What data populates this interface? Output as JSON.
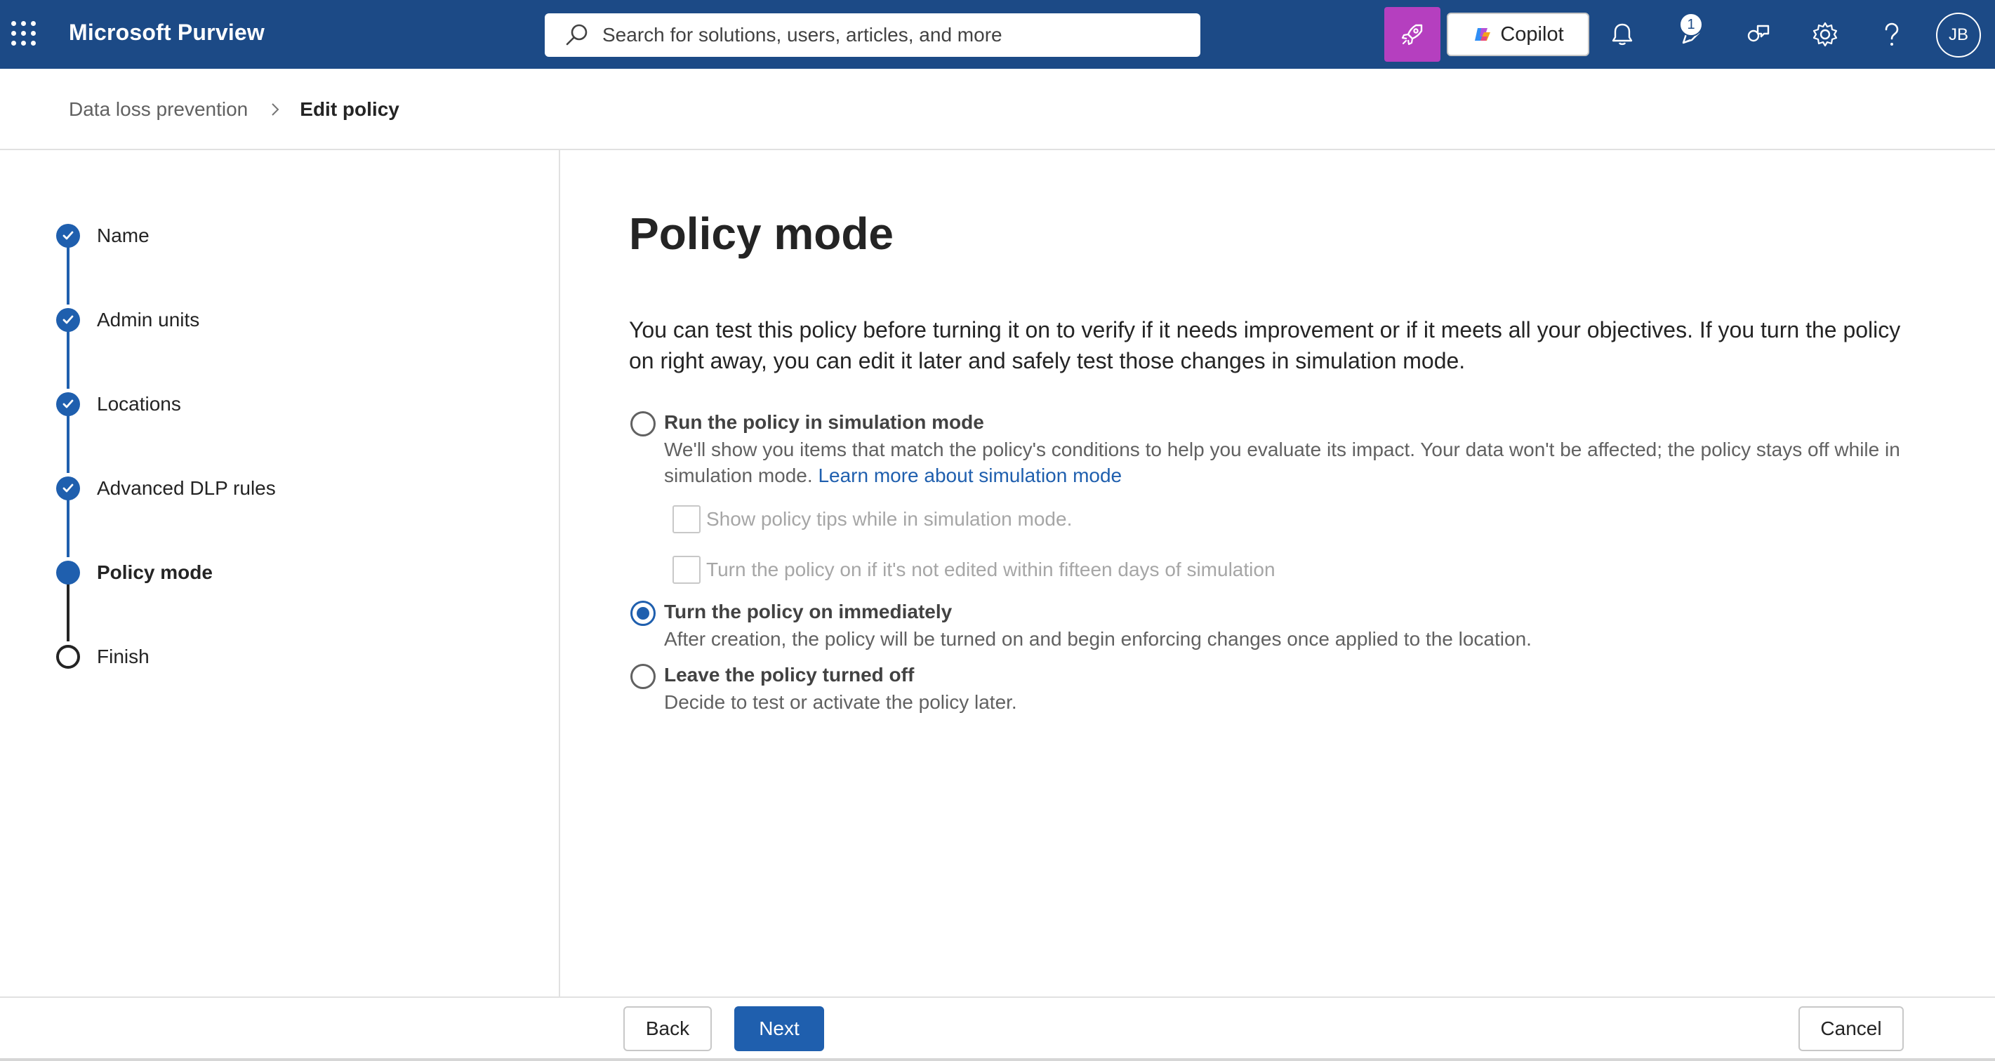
{
  "app": {
    "title": "Microsoft Purview"
  },
  "search": {
    "placeholder": "Search for solutions, users, articles, and more"
  },
  "topbar": {
    "copilot_label": "Copilot",
    "notification_badge": "1",
    "avatar_initials": "JB",
    "colors": {
      "bar": "#1c4a86",
      "rocket": "#b53fbf"
    }
  },
  "breadcrumb": {
    "parent": "Data loss prevention",
    "current": "Edit policy"
  },
  "wizard": {
    "steps": [
      {
        "label": "Name",
        "state": "done"
      },
      {
        "label": "Admin units",
        "state": "done"
      },
      {
        "label": "Locations",
        "state": "done"
      },
      {
        "label": "Advanced DLP rules",
        "state": "done"
      },
      {
        "label": "Policy mode",
        "state": "current"
      },
      {
        "label": "Finish",
        "state": "todo"
      }
    ]
  },
  "main": {
    "title": "Policy mode",
    "description": "You can test this policy before turning it on to verify if it needs improvement or if it meets all your objectives. If you turn the policy on right away, you can edit it later and safely test those changes in simulation mode.",
    "options": [
      {
        "title": "Run the policy in simulation mode",
        "description": "We'll show you items that match the policy's conditions to help you evaluate its impact. Your data won't be affected; the policy stays off while in simulation mode.",
        "link": "Learn more about simulation mode",
        "checked": false,
        "suboptions": [
          {
            "label": "Show policy tips while in simulation mode.",
            "checked": false,
            "disabled": true
          },
          {
            "label": "Turn the policy on if it's not edited within fifteen days of simulation",
            "checked": false,
            "disabled": true
          }
        ]
      },
      {
        "title": "Turn the policy on immediately",
        "description": "After creation, the policy will be turned on and begin enforcing changes once applied to the location.",
        "checked": true
      },
      {
        "title": "Leave the policy turned off",
        "description": "Decide to test or activate the policy later.",
        "checked": false
      }
    ]
  },
  "footer": {
    "back_label": "Back",
    "next_label": "Next",
    "cancel_label": "Cancel"
  }
}
